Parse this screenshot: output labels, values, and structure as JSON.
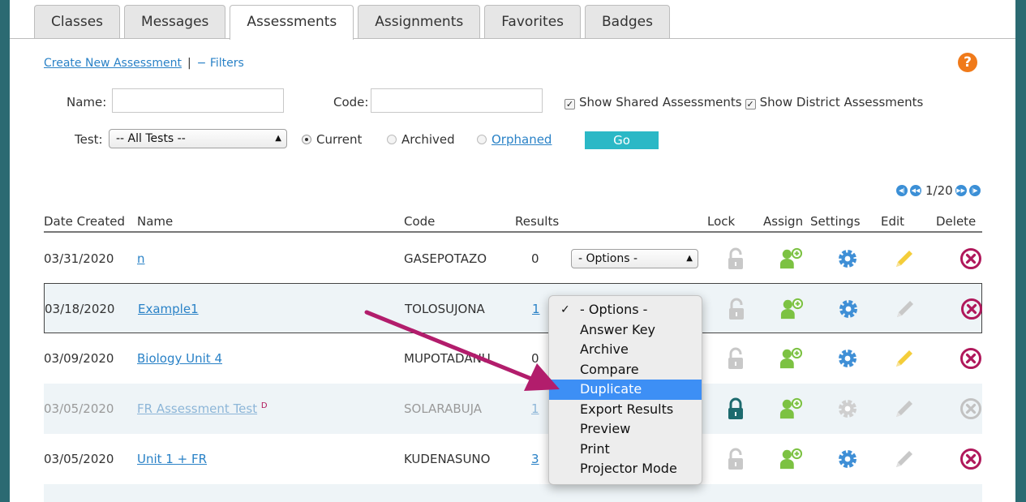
{
  "tabs": [
    "Classes",
    "Messages",
    "Assessments",
    "Assignments",
    "Favorites",
    "Badges"
  ],
  "links": {
    "create": "Create New Assessment",
    "separator": "|",
    "filters": "− Filters"
  },
  "help": "?",
  "filters": {
    "name_label": "Name:",
    "code_label": "Code:",
    "show_shared": "Show Shared Assessments",
    "show_district": "Show District Assessments",
    "test_label": "Test:",
    "test_value": "-- All Tests --",
    "radio_current": "Current",
    "radio_archived": "Archived",
    "radio_orphaned": "Orphaned",
    "go": "Go"
  },
  "pager": {
    "text": "1/20"
  },
  "table": {
    "headers": [
      "Date Created",
      "Name",
      "Code",
      "Results",
      "Lock",
      "Assign",
      "Settings",
      "Edit",
      "Delete"
    ],
    "rows": [
      {
        "date": "03/31/2020",
        "name": "n",
        "code": "GASEPOTAZO",
        "results": "0",
        "option": "- Options -"
      },
      {
        "date": "03/18/2020",
        "name": "Example1",
        "code": "TOLOSUJONA",
        "results": "1",
        "option": ""
      },
      {
        "date": "03/09/2020",
        "name": "Biology Unit 4",
        "code": "MUPOTADANU",
        "results": "0",
        "option": ""
      },
      {
        "date": "03/05/2020",
        "name": "FR Assessment Test",
        "name_sup": "D",
        "code": "SOLARABUJA",
        "results": "1",
        "option": ""
      },
      {
        "date": "03/05/2020",
        "name": "Unit 1 + FR",
        "code": "KUDENASUNO",
        "results": "3",
        "option": ""
      }
    ]
  },
  "dropdown_menu": {
    "tick": "✓",
    "items": [
      "- Options -",
      "Answer Key",
      "Archive",
      "Compare",
      "Duplicate",
      "Export Results",
      "Preview",
      "Print",
      "Projector Mode"
    ],
    "highlighted": "Duplicate"
  },
  "colors": {
    "accent_link": "#2a82c7",
    "go_button": "#2bb8c6",
    "assign_green": "#7cc242",
    "settings_blue": "#3f8fd6",
    "edit_yellow": "#f4cd3a",
    "delete_magenta": "#b0185b",
    "annotation_arrow": "#b21d6c"
  }
}
